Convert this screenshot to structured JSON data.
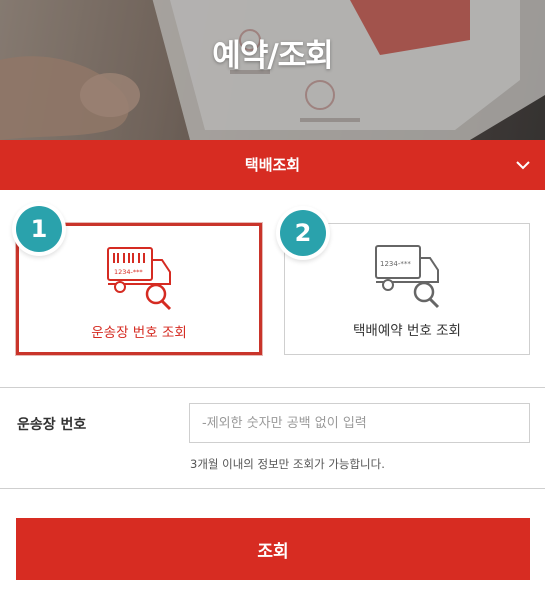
{
  "hero": {
    "title": "예약/조회"
  },
  "category_bar": {
    "label": "택배조회",
    "chevron_icon": "chevron-down-icon"
  },
  "options": [
    {
      "step": "1",
      "label": "운송장 번호 조회",
      "icon": "truck-barcode-search-icon",
      "icon_text": "1234-***",
      "selected": true
    },
    {
      "step": "2",
      "label": "택배예약 번호 조회",
      "icon": "truck-number-search-icon",
      "icon_text": "1234-***",
      "selected": false
    }
  ],
  "form": {
    "field_label": "운송장 번호",
    "input_value": "",
    "input_placeholder": "-제외한 숫자만 공백 없이 입력",
    "note": "3개월 이내의 정보만 조회가 가능합니다."
  },
  "submit": {
    "label": "조회"
  },
  "colors": {
    "brand_red": "#d72c22",
    "step_teal": "#2aa2ac",
    "border_gray": "#cfcfcf"
  }
}
